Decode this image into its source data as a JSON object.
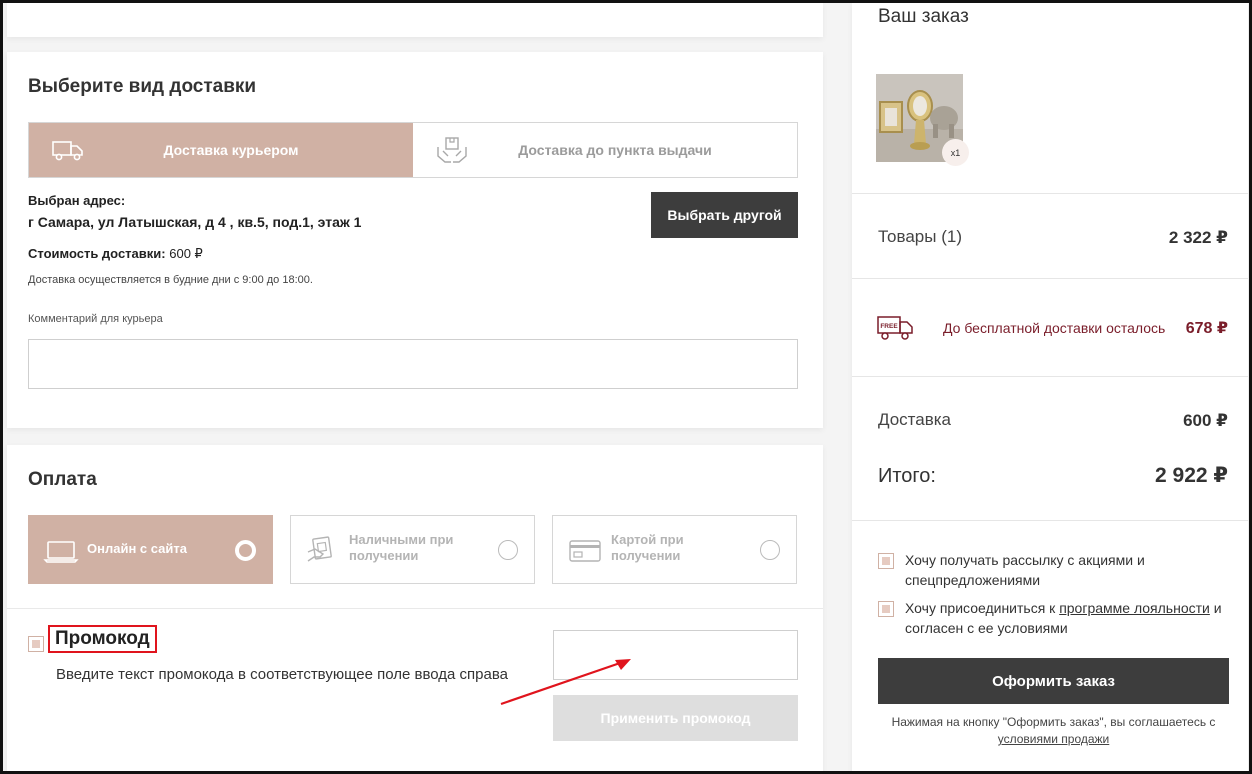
{
  "delivery": {
    "title": "Выберите вид доставки",
    "tabs": [
      {
        "label": "Доставка курьером",
        "icon": "truck-icon",
        "active": true
      },
      {
        "label": "Доставка до пункта выдачи",
        "icon": "parcel-hands-icon",
        "active": false
      }
    ],
    "address_label": "Выбран адрес:",
    "address_value": "г Самара, ул Латышская, д 4 , кв.5, под.1, этаж 1",
    "choose_other_label": "Выбрать другой",
    "cost_label": "Стоимость доставки:",
    "cost_value": "600 ₽",
    "schedule_note": "Доставка осуществляется в будние дни с 9:00 до 18:00.",
    "comment_label": "Комментарий для курьера",
    "comment_value": ""
  },
  "payment": {
    "title": "Оплата",
    "options": [
      {
        "label": "Онлайн с сайта",
        "icon": "laptop-icon",
        "selected": true
      },
      {
        "label_line1": "Наличными при",
        "label_line2": "получении",
        "icon": "cash-icon",
        "selected": false
      },
      {
        "label_line1": "Картой при",
        "label_line2": "получении",
        "icon": "card-icon",
        "selected": false
      }
    ]
  },
  "promo": {
    "title": "Промокод",
    "hint": "Введите текст промокода в соответствующее поле ввода справа",
    "input_value": "",
    "apply_label": "Применить промокод"
  },
  "summary": {
    "title": "Ваш заказ",
    "qty_badge": "x1",
    "items_label": "Товары (1)",
    "items_value": "2 322 ₽",
    "free_delivery_text": "До бесплатной доставки осталось",
    "free_delivery_value": "678 ₽",
    "free_icon_text": "FREE",
    "delivery_label": "Доставка",
    "delivery_value": "600 ₽",
    "total_label": "Итого:",
    "total_value": "2 922 ₽",
    "newsletter_text": "Хочу получать рассылку с акциями и спецпредложениями",
    "loyalty_prefix": "Хочу присоединиться к ",
    "loyalty_link": "программе лояльности",
    "loyalty_suffix": " и согласен с ее условиями",
    "order_button": "Оформить заказ",
    "legal_text": "Нажимая на кнопку \"Оформить заказ\", вы соглашаетесь с",
    "legal_link": "условиями продажи"
  },
  "colors": {
    "accent": "#d0b1a4",
    "dark_button": "#3d3d3d",
    "highlight_red": "#e0141d",
    "free_delivery": "#7a1d2a"
  }
}
